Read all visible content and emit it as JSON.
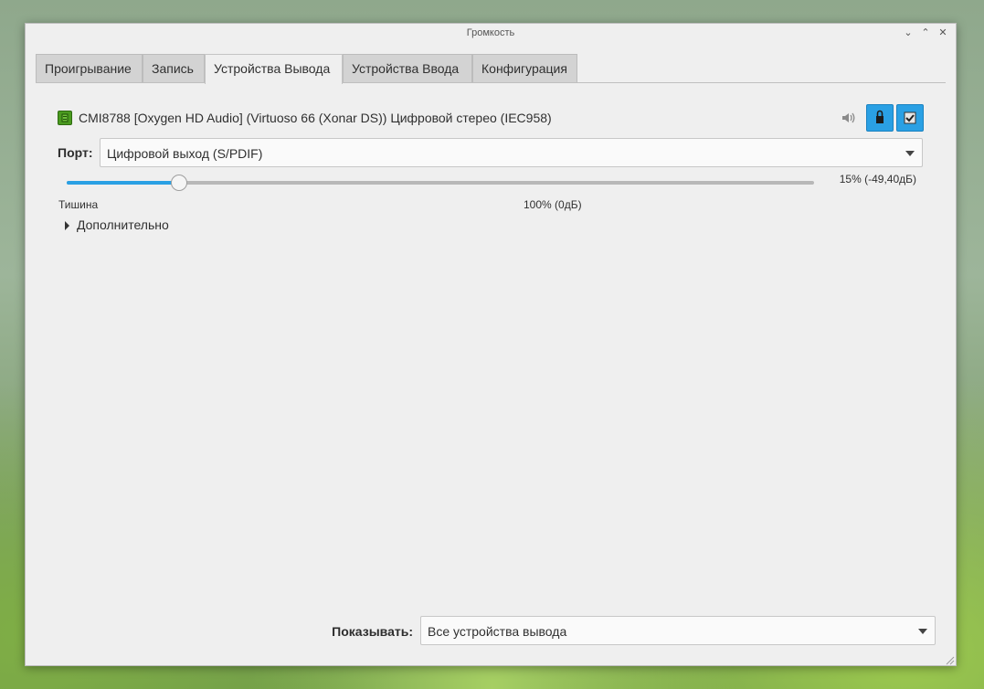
{
  "window": {
    "title": "Громкость",
    "controls": {
      "minimize": "⌄",
      "maximize": "⌃",
      "close": "✕"
    }
  },
  "tabs": [
    {
      "label": "Проигрывание",
      "active": false
    },
    {
      "label": "Запись",
      "active": false
    },
    {
      "label": "Устройства Вывода",
      "active": true
    },
    {
      "label": "Устройства Ввода",
      "active": false
    },
    {
      "label": "Конфигурация",
      "active": false
    }
  ],
  "device": {
    "name": "CMI8788 [Oxygen HD Audio] (Virtuoso 66 (Xonar DS)) Цифровой стерео (IEC958)",
    "icon": "sound-card-icon",
    "port_label": "Порт:",
    "port_value": "Цифровой выход (S/PDIF)",
    "volume_fraction": 0.15,
    "volume_text": "15% (-49,40дБ)",
    "scale_min_label": "Тишина",
    "scale_norm_label": "100% (0дБ)",
    "advanced_label": "Дополнительно"
  },
  "footer": {
    "show_label": "Показывать:",
    "show_value": "Все устройства вывода"
  },
  "colors": {
    "accent": "#2aa0e4",
    "window_bg": "#efefef"
  }
}
